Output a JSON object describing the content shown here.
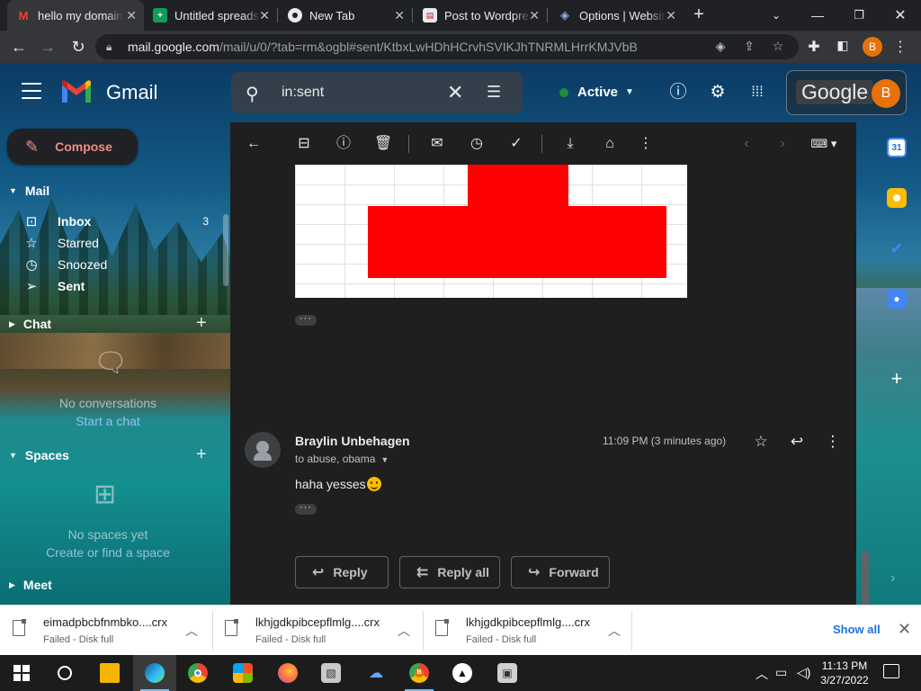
{
  "browser": {
    "tabs": [
      {
        "title": "hello my domain",
        "favicon": "gmail-icon",
        "active": true
      },
      {
        "title": "Untitled spreadsheet",
        "favicon": "sheets-icon",
        "active": false
      },
      {
        "title": "New Tab",
        "favicon": "chrome-icon",
        "active": false
      },
      {
        "title": "Post to Wordpress",
        "favicon": "wordpress-icon",
        "active": false
      },
      {
        "title": "Options | Website",
        "favicon": "extension-icon",
        "active": false
      }
    ],
    "url_host": "mail.google.com",
    "url_path": "/mail/u/0/?tab=rm&ogbl#sent/KtbxLwHDhHCrvhSVIKJhTNRMLHrrKMJVbB",
    "profile_initial": "B"
  },
  "gmail": {
    "product_name": "Gmail",
    "search_query": "in:sent",
    "status_label": "Active",
    "google_label": "Google",
    "avatar_initial": "B",
    "compose_label": "Compose",
    "mail_section": "Mail",
    "nav_items": [
      {
        "label": "Inbox",
        "count": "3",
        "icon": "inbox-icon",
        "bold": true
      },
      {
        "label": "Starred",
        "count": "",
        "icon": "star-icon",
        "bold": false
      },
      {
        "label": "Snoozed",
        "count": "",
        "icon": "clock-icon",
        "bold": false
      },
      {
        "label": "Sent",
        "count": "",
        "icon": "send-icon",
        "bold": true
      }
    ],
    "chat_section": "Chat",
    "chat_empty": "No conversations",
    "chat_link": "Start a chat",
    "spaces_section": "Spaces",
    "spaces_empty": "No spaces yet",
    "spaces_link": "Create or find a space",
    "meet_section": "Meet"
  },
  "message": {
    "sender": "Braylin Unbehagen",
    "recipients": "to abuse, obama",
    "time": "11:09 PM (3 minutes ago)",
    "body": "haha yesses",
    "emoji": "winking-face-emoji",
    "actions": {
      "reply": "Reply",
      "reply_all": "Reply all",
      "forward": "Forward"
    }
  },
  "downloads": {
    "items": [
      {
        "name": "eimadpbcbfnmbko....crx",
        "status": "Failed - Disk full"
      },
      {
        "name": "lkhjgdkpibcepflmlg....crx",
        "status": "Failed - Disk full"
      },
      {
        "name": "lkhjgdkpibcepflmlg....crx",
        "status": "Failed - Disk full"
      }
    ],
    "show_all": "Show all"
  },
  "taskbar": {
    "time": "11:13 PM",
    "date": "3/27/2022"
  },
  "colors": {
    "accent_compose": "#f28b82",
    "avatar_orange": "#e8710a",
    "status_green": "#1e8e3e",
    "sheet_red": "#ff0000"
  }
}
